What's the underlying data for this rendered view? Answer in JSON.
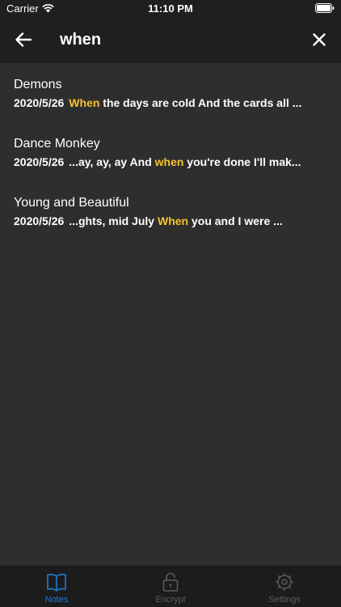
{
  "status": {
    "carrier": "Carrier",
    "time": "11:10 PM"
  },
  "search": {
    "query": "when",
    "back_icon": "arrow-left-icon",
    "clear_icon": "close-icon"
  },
  "results": [
    {
      "title": "Demons",
      "date": "2020/5/26",
      "pre": "",
      "match": "When",
      "post": " the days are cold And the cards all ..."
    },
    {
      "title": "Dance Monkey",
      "date": "2020/5/26",
      "pre": "...ay, ay, ay And ",
      "match": "when",
      "post": " you're done I'll mak..."
    },
    {
      "title": "Young and Beautiful",
      "date": "2020/5/26",
      "pre": "...ghts, mid July ",
      "match": "When",
      "post": " you and I were ..."
    }
  ],
  "tabbar": {
    "tabs": [
      {
        "label": "Notes",
        "icon": "book-icon",
        "active": true
      },
      {
        "label": "Encrypt",
        "icon": "lock-icon",
        "active": false
      },
      {
        "label": "Settings",
        "icon": "gear-icon",
        "active": false
      }
    ]
  },
  "colors": {
    "highlight": "#f2c230",
    "accent": "#1f7bd6",
    "background": "#2e2e2e",
    "header": "#1f1f1f"
  }
}
